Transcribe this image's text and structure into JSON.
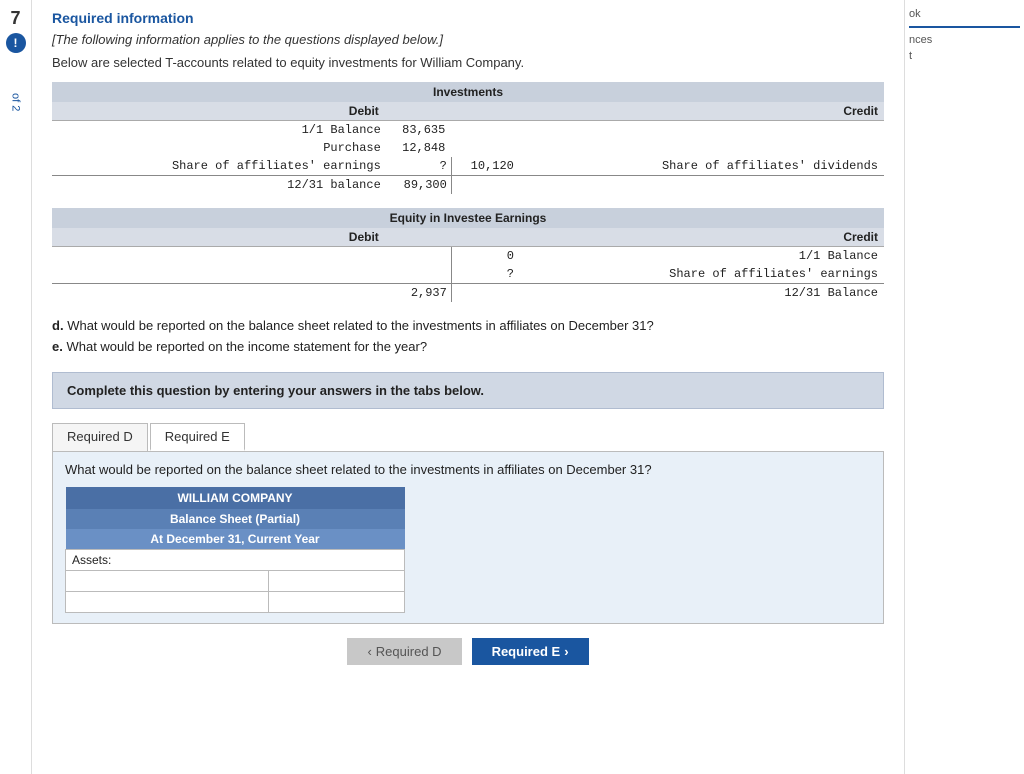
{
  "sidebar": {
    "number": "7",
    "alert": "!",
    "of_label": "of 2"
  },
  "required_info": {
    "title": "Required information",
    "italic_text": "[The following information applies to the questions displayed below.]",
    "below_text": "Below are selected T-accounts related to equity investments for William Company."
  },
  "investments_table": {
    "title": "Investments",
    "debit_header": "Debit",
    "credit_header": "Credit",
    "rows": [
      {
        "left_label": "1/1 Balance",
        "left_val": "83,635",
        "right_val": "",
        "right_label": ""
      },
      {
        "left_label": "Purchase",
        "left_val": "12,848",
        "right_val": "",
        "right_label": ""
      },
      {
        "left_label": "Share of affiliates' earnings",
        "left_val": "?",
        "right_val": "10,120",
        "right_label": "Share of affiliates' dividends"
      },
      {
        "left_label": "12/31 balance",
        "left_val": "89,300",
        "right_val": "",
        "right_label": ""
      }
    ]
  },
  "equity_table": {
    "title": "Equity in Investee Earnings",
    "debit_header": "Debit",
    "credit_header": "Credit",
    "rows": [
      {
        "left_val": "",
        "right_val": "0",
        "right_label": "1/1 Balance"
      },
      {
        "left_val": "",
        "right_val": "?",
        "right_label": "Share of affiliates' earnings"
      },
      {
        "left_val": "2,937",
        "right_val": "",
        "right_label": "12/31 Balance"
      }
    ]
  },
  "questions": {
    "d_letter": "d.",
    "d_text": "What would be reported on the balance sheet related to the investments in affiliates on December 31?",
    "e_letter": "e.",
    "e_text": "What would be reported on the income statement for the year?"
  },
  "complete_box": {
    "text": "Complete this question by entering your answers in the tabs below."
  },
  "tabs": {
    "tab1_label": "Required D",
    "tab2_label": "Required E",
    "active": "tab1"
  },
  "tab_content": {
    "question": "What would be reported on the balance sheet related to the investments in affiliates on December 31?"
  },
  "company_table": {
    "company_name": "WILLIAM COMPANY",
    "subtitle1": "Balance Sheet (Partial)",
    "subtitle2": "At December 31, Current Year",
    "assets_label": "Assets:",
    "rows": [
      {
        "label": "",
        "value": ""
      },
      {
        "label": "",
        "value": ""
      }
    ]
  },
  "navigation": {
    "prev_label": "Required D",
    "prev_icon": "‹",
    "next_label": "Required E",
    "next_icon": "›"
  },
  "right_panel": {
    "items": [
      "ok",
      "nces",
      "t"
    ]
  }
}
